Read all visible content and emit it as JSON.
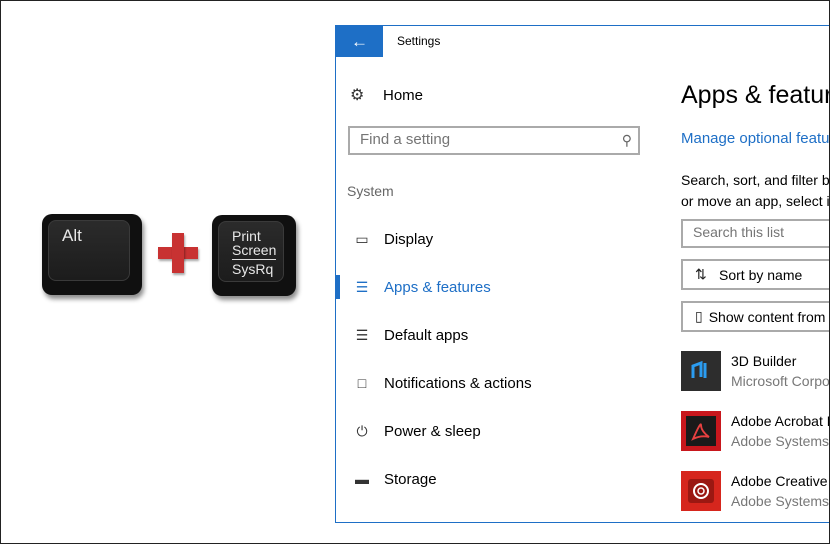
{
  "keys": {
    "alt": "Alt",
    "print_line1": "Print",
    "print_line2": "Screen",
    "print_line3": "SysRq"
  },
  "window": {
    "title": "Settings",
    "back_icon": "back-arrow-icon",
    "accent": "#1e6fc6"
  },
  "sidebar": {
    "home": "Home",
    "search_placeholder": "Find a setting",
    "group": "System",
    "items": [
      {
        "label": "Display",
        "icon": "monitor-icon"
      },
      {
        "label": "Apps & features",
        "icon": "list-icon"
      },
      {
        "label": "Default apps",
        "icon": "default-apps-icon"
      },
      {
        "label": "Notifications & actions",
        "icon": "message-icon"
      },
      {
        "label": "Power & sleep",
        "icon": "power-icon"
      },
      {
        "label": "Storage",
        "icon": "drive-icon"
      }
    ]
  },
  "main": {
    "title": "Apps & features",
    "manage_link": "Manage optional features",
    "desc_line1": "Search, sort, and filter by drive. If you would like to uninstall",
    "desc_line2": "or move an app, select it from the list.",
    "search_placeholder": "Search this list",
    "sort_label": "Sort by name",
    "show_label": "Show content from all drives",
    "apps": [
      {
        "name": "3D Builder",
        "publisher": "Microsoft Corporation"
      },
      {
        "name": "Adobe Acrobat Reader DC",
        "publisher": "Adobe Systems Incorporated"
      },
      {
        "name": "Adobe Creative Cloud",
        "publisher": "Adobe Systems Incorporated"
      }
    ]
  }
}
